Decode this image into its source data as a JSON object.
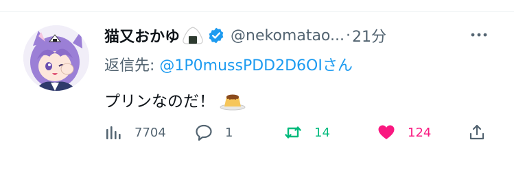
{
  "tweet": {
    "display_name": "猫又おかゆ",
    "name_emoji": "rice-ball-emoji",
    "verified": true,
    "handle": "@nekomatao...",
    "dot": "·",
    "time": "21分",
    "reply_prefix": "返信先: ",
    "reply_handle": "@1P0mussPDD2D6OIさん",
    "text": "プリンなのだ！",
    "text_emoji": "custard-pudding-emoji",
    "colors": {
      "link": "#1d9bf0",
      "muted": "#536471",
      "retweet": "#00ba7c",
      "like": "#f91880"
    }
  },
  "actions": {
    "views_count": "7704",
    "reply_count": "1",
    "retweet_count": "14",
    "like_count": "124"
  },
  "icons": {
    "views": "bar-chart-icon",
    "reply": "speech-bubble-icon",
    "retweet": "retweet-arrows-icon",
    "like": "heart-icon",
    "share": "share-upload-icon",
    "more": "more-dots-icon"
  }
}
